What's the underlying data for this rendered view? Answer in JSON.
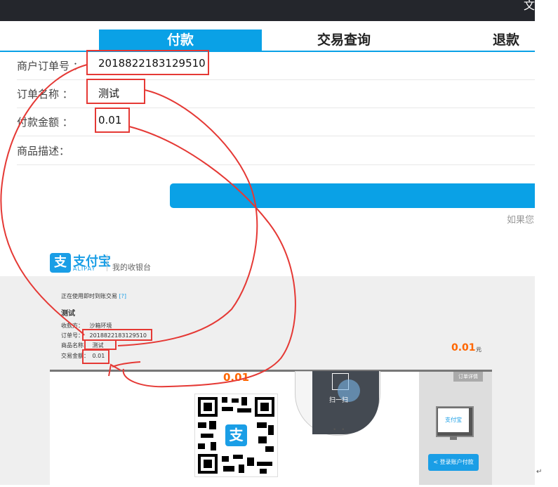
{
  "topbar": {
    "close_glyph": "文"
  },
  "tabs": [
    {
      "label": "付款"
    },
    {
      "label": "交易查询"
    },
    {
      "label": "退款"
    }
  ],
  "form": {
    "order_no": {
      "label": "商户订单号 ：",
      "value": "2018822183129510"
    },
    "order_name": {
      "label": "订单名称 ：",
      "value": "测试"
    },
    "amount": {
      "label": "付款金额 ：",
      "value": "0.01"
    },
    "desc": {
      "label": "商品描述：",
      "value": ""
    }
  },
  "hint": "如果您",
  "alipay": {
    "logo_char": "支",
    "logo_text": "支付宝",
    "logo_sub": "ALIPAY",
    "cashier": "我的收银台",
    "notice_prefix": "正在使用即时到账交易",
    "notice_link": "[?]",
    "title": "测试",
    "rows": [
      {
        "label": "收款方：",
        "value": "沙箱环境"
      },
      {
        "label": "订单号：",
        "value": "2018822183129510"
      },
      {
        "label": "商品名称：",
        "value": "测试"
      },
      {
        "label": "交易金额：",
        "value": "0.01"
      }
    ],
    "amount_right": "0.01",
    "yuan": "元",
    "qr_amount": "0.01",
    "scan_text": "扫一扫",
    "dots": "• •",
    "detail_button": "订单详情",
    "monitor_logo": "支付宝",
    "login_button": "< 登录账户付款"
  },
  "edge_mark": "↵",
  "colors": {
    "accent": "#0aa1e6",
    "annotation": "#e53935",
    "amount": "#ff6600"
  }
}
